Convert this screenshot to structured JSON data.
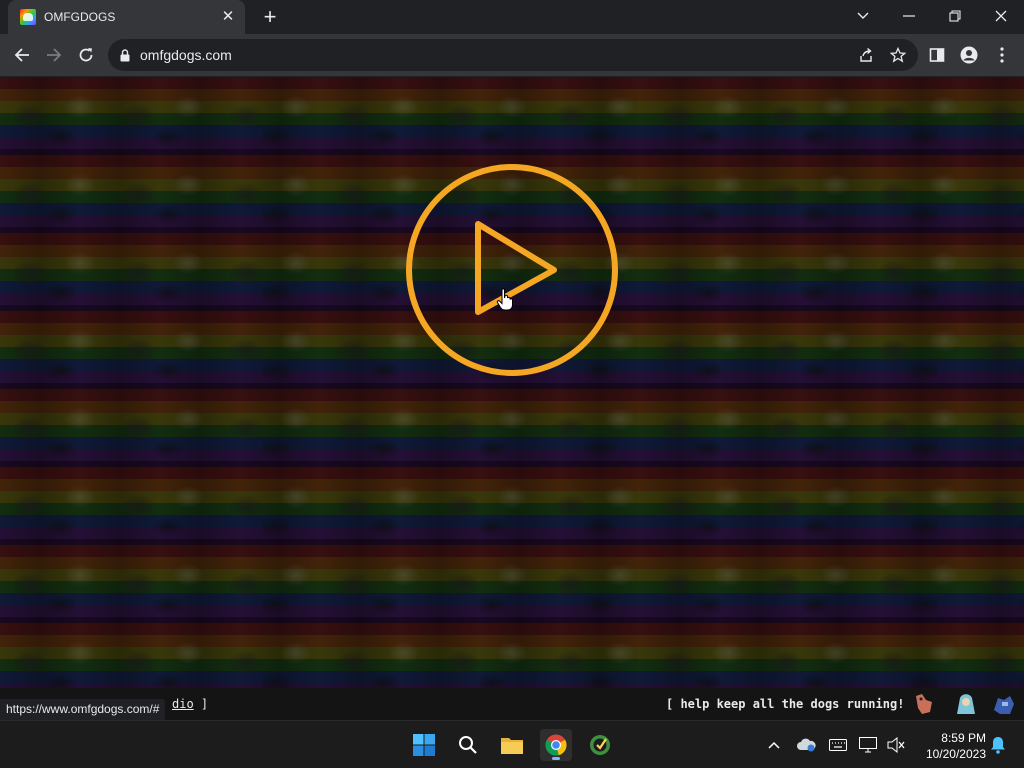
{
  "browser": {
    "tab": {
      "title": "OMFGDOGS",
      "favicon": "omfgdogs-favicon",
      "close_icon": "close-icon"
    },
    "new_tab_label": "+",
    "address_bar": {
      "url": "omfgdogs.com"
    }
  },
  "page": {
    "play_button_color": "#f5a623",
    "footer": {
      "radio_fragment": "dio",
      "radio_bracket": "]",
      "help_text": "[ help keep all the dogs running! ]"
    },
    "status_bar_url": "https://www.omfgdogs.com/#"
  },
  "taskbar": {
    "clock": {
      "time": "8:59 PM",
      "date": "10/20/2023"
    }
  }
}
